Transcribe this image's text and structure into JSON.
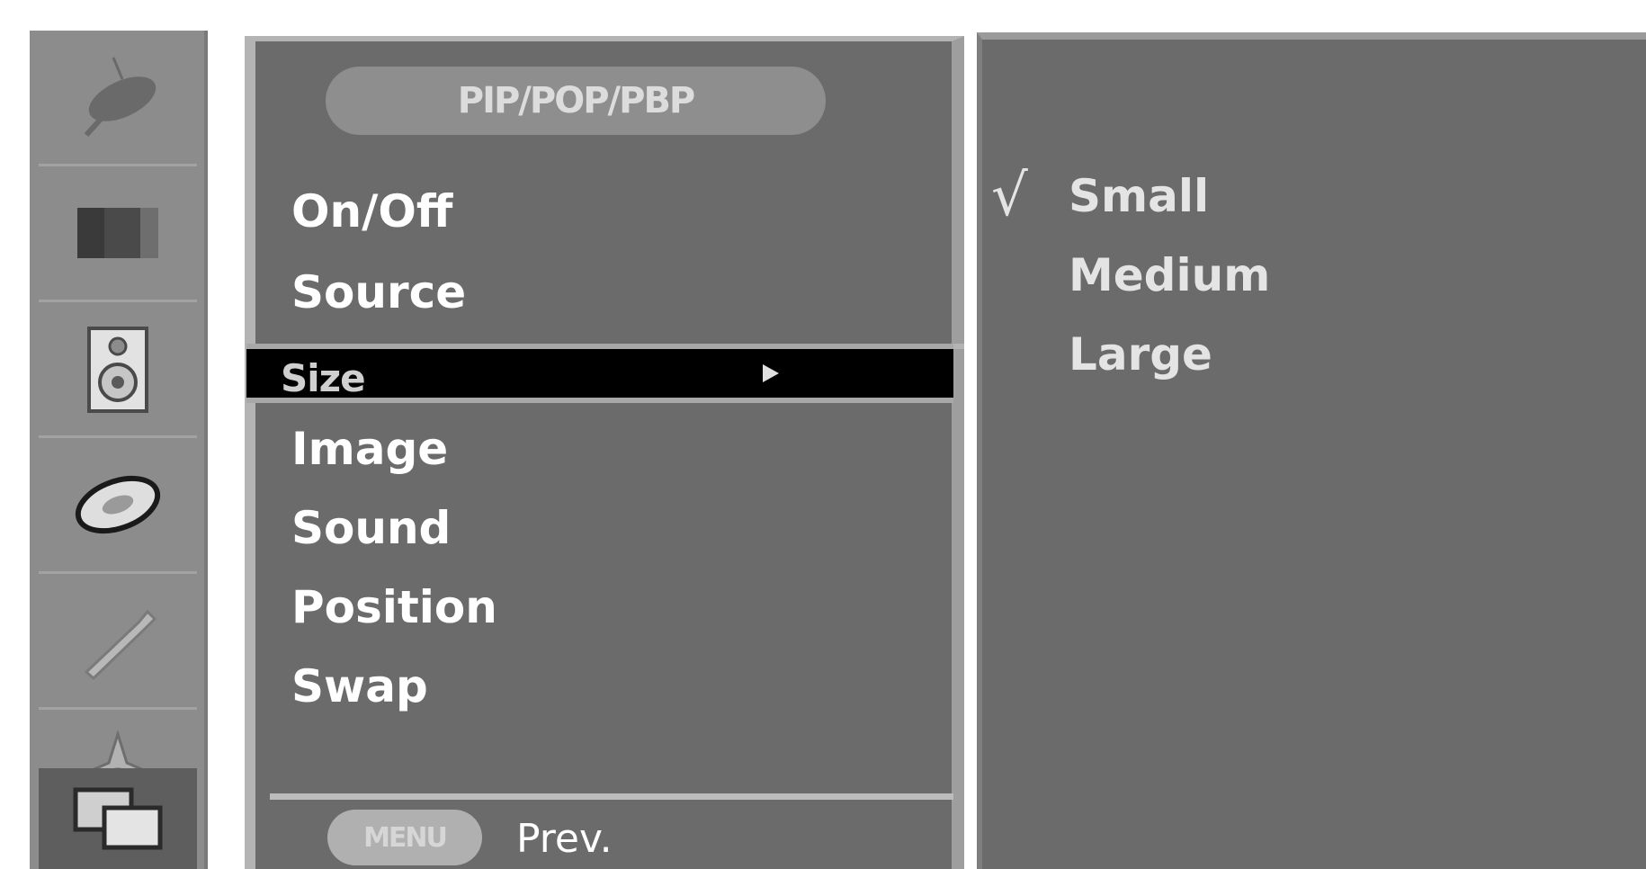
{
  "sidebar": {
    "icons": [
      "satellite-dish-icon",
      "picture-icon",
      "speaker-icon",
      "disc-icon",
      "wrench-icon",
      "crosshair-icon",
      "pip-icon"
    ],
    "active_index": 6
  },
  "menu": {
    "title": "PIP/POP/PBP",
    "items": [
      "On/Off",
      "Source",
      "Size",
      "Image",
      "Sound",
      "Position",
      "Swap"
    ],
    "selected_index": 2,
    "footer": {
      "key_label": "MENU",
      "prev_label": "Prev."
    }
  },
  "submenu": {
    "options": [
      "Small",
      "Medium",
      "Large"
    ],
    "checked_index": 0,
    "check_symbol": "√"
  }
}
